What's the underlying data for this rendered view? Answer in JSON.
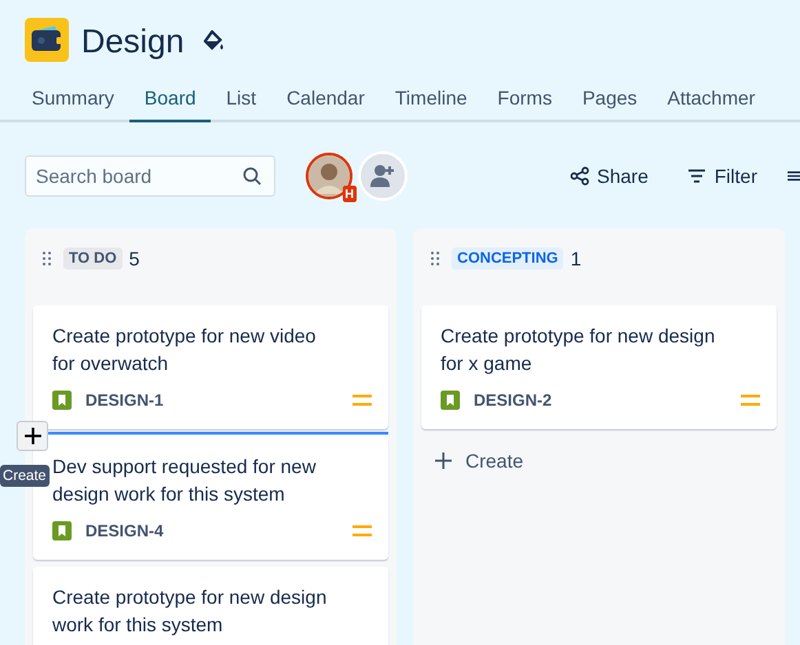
{
  "project": {
    "title": "Design"
  },
  "tabs": [
    {
      "label": "Summary",
      "selected": false
    },
    {
      "label": "Board",
      "selected": true
    },
    {
      "label": "List",
      "selected": false
    },
    {
      "label": "Calendar",
      "selected": false
    },
    {
      "label": "Timeline",
      "selected": false
    },
    {
      "label": "Forms",
      "selected": false
    },
    {
      "label": "Pages",
      "selected": false
    },
    {
      "label": "Attachmer",
      "selected": false
    }
  ],
  "search": {
    "placeholder": "Search board"
  },
  "avatar": {
    "badge": "H"
  },
  "toolbar": [
    "Share",
    "Filter"
  ],
  "columns": [
    {
      "status": "TO DO",
      "kind": "todo",
      "count": "5",
      "cards": [
        {
          "title": "Create prototype for new video for overwatch",
          "key": "DESIGN-1"
        },
        {
          "title": "Dev support requested for new design work for this system",
          "key": "DESIGN-4"
        },
        {
          "title": "Create prototype for new design work for this system"
        }
      ]
    },
    {
      "status": "CONCEPTING",
      "kind": "progress",
      "count": "1",
      "cards": [
        {
          "title": "Create prototype for new design for x game",
          "key": "DESIGN-2"
        }
      ],
      "create": "Create"
    }
  ],
  "tooltip": "Create"
}
